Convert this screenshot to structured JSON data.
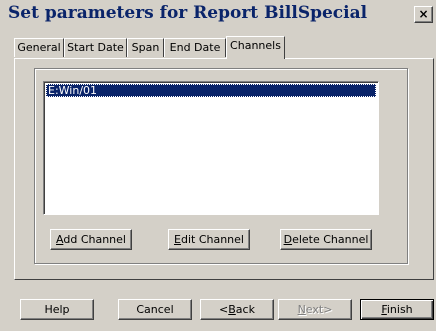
{
  "window": {
    "title": "Set parameters for Report BillSpecial",
    "close_glyph": "×"
  },
  "tabs": [
    {
      "label": "General",
      "active": false
    },
    {
      "label": "Start Date",
      "active": false
    },
    {
      "label": "Span",
      "active": false
    },
    {
      "label": "End Date",
      "active": false
    },
    {
      "label": "Channels",
      "active": true
    }
  ],
  "channels": {
    "items": [
      "E:Win/01"
    ],
    "selected_index": 0,
    "add_mnemonic": "A",
    "add_rest": "dd Channel",
    "edit_mnemonic": "E",
    "edit_rest": "dit Channel",
    "delete_mnemonic": "D",
    "delete_rest": "elete Channel"
  },
  "footer": {
    "help": "Help",
    "cancel": "Cancel",
    "back_prefix": "<",
    "back_mnemonic": "B",
    "back_rest": "ack",
    "next_mnemonic": "N",
    "next_rest": "ext>",
    "finish_mnemonic": "F",
    "finish_rest": "inish"
  },
  "colors": {
    "face": "#d4d0c8",
    "title_text": "#0a246a",
    "selection": "#0a246a"
  }
}
